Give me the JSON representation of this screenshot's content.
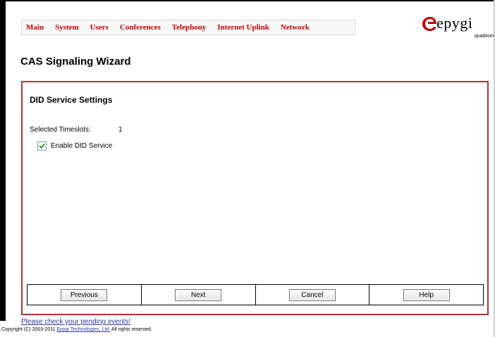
{
  "nav": {
    "items": [
      {
        "label": "Main"
      },
      {
        "label": "System"
      },
      {
        "label": "Users"
      },
      {
        "label": "Conferences"
      },
      {
        "label": "Telephony"
      },
      {
        "label": "Internet Uplink"
      },
      {
        "label": "Network"
      }
    ]
  },
  "brand": {
    "name": "epygi",
    "sub": "quadrom",
    "accent_color": "#c00000"
  },
  "page": {
    "title": "CAS Signaling Wizard"
  },
  "panel": {
    "section_title": "DID Service Settings",
    "timeslots_label": "Selected Timeslots:",
    "timeslots_value": "1",
    "enable_did": {
      "label": "Enable DID Service",
      "checked": true
    },
    "border_color": "#b03535"
  },
  "buttons": {
    "previous": "Previous",
    "next": "Next",
    "cancel": "Cancel",
    "help": "Help"
  },
  "footer": {
    "pending_link": "Please check your pending events!",
    "copyright_prefix": "Copyright (C) 2003-2011 ",
    "copyright_company": "Epygi Technologies, Ltd.",
    "copyright_suffix": " All rights reserved."
  }
}
